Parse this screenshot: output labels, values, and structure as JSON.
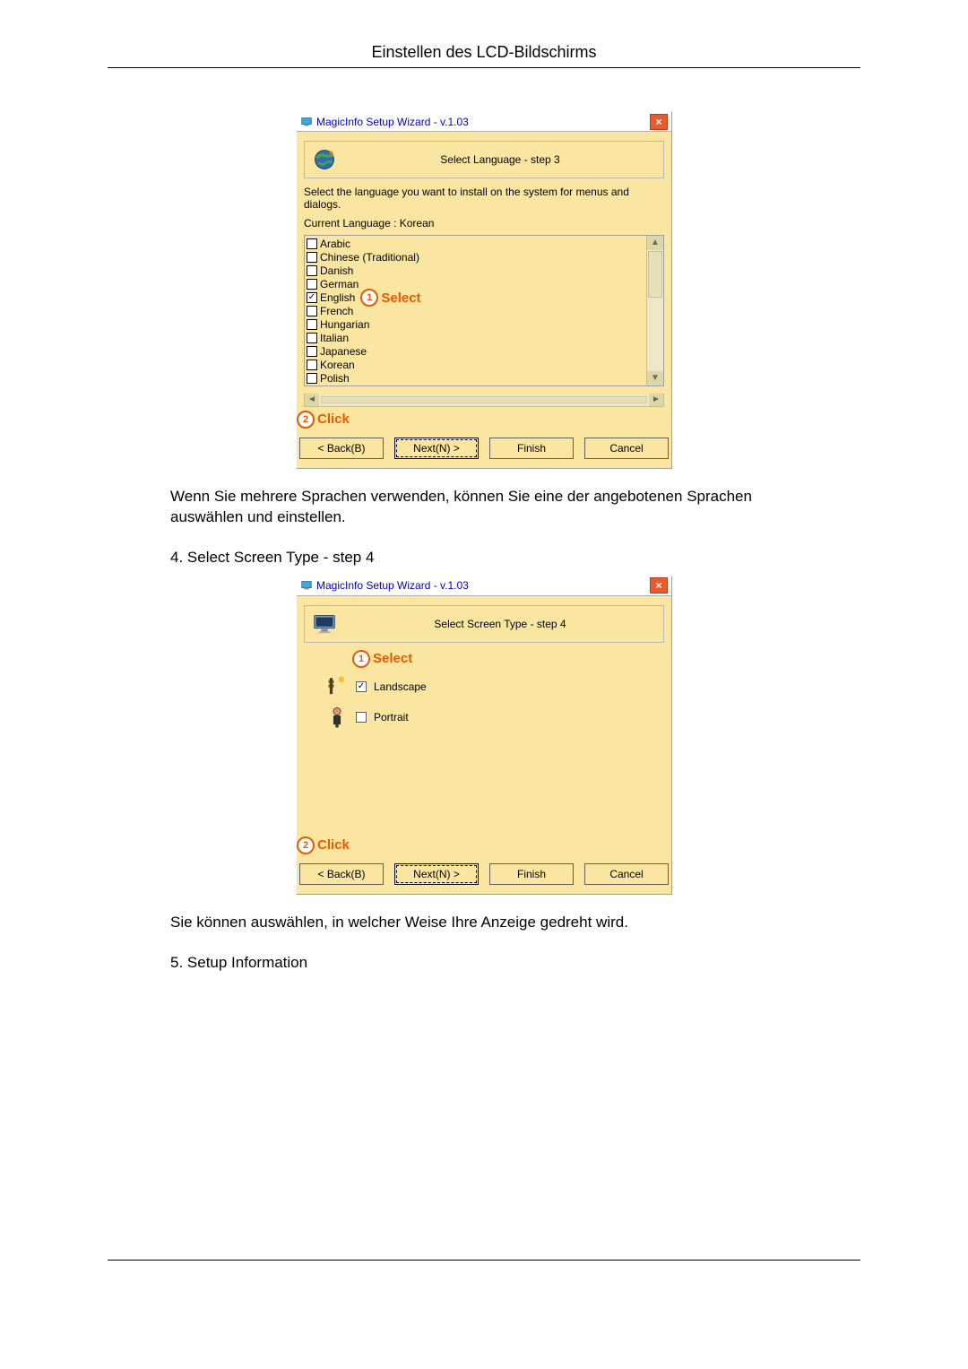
{
  "page": {
    "header": "Einstellen des LCD-Bildschirms",
    "paragraph_after_step3": "Wenn Sie mehrere Sprachen verwenden, können Sie eine der angebotenen Sprachen auswählen und einstellen.",
    "step4_heading": "4. Select Screen Type - step 4",
    "paragraph_after_step4": "Sie können auswählen, in welcher Weise Ihre Anzeige gedreht wird.",
    "step5_heading": "5. Setup Information"
  },
  "callouts": {
    "select": "Select",
    "click": "Click",
    "num1": "1",
    "num2": "2"
  },
  "common": {
    "window_title": "MagicInfo Setup Wizard - v.1.03",
    "close": "×",
    "back": "< Back(B)",
    "next": "Next(N) >",
    "finish": "Finish",
    "cancel": "Cancel"
  },
  "step3": {
    "banner": "Select Language - step 3",
    "instruction": "Select the language you want to install on the system for menus and dialogs.",
    "current_label": "Current Language   :   Korean",
    "languages": [
      {
        "label": "Arabic",
        "checked": false
      },
      {
        "label": "Chinese (Traditional)",
        "checked": false
      },
      {
        "label": "Danish",
        "checked": false
      },
      {
        "label": "German",
        "checked": false
      },
      {
        "label": "English",
        "checked": true
      },
      {
        "label": "French",
        "checked": false
      },
      {
        "label": "Hungarian",
        "checked": false
      },
      {
        "label": "Italian",
        "checked": false
      },
      {
        "label": "Japanese",
        "checked": false
      },
      {
        "label": "Korean",
        "checked": false
      },
      {
        "label": "Polish",
        "checked": false
      }
    ]
  },
  "step4": {
    "banner": "Select Screen Type - step 4",
    "options": [
      {
        "label": "Landscape",
        "checked": true
      },
      {
        "label": "Portrait",
        "checked": false
      }
    ]
  }
}
